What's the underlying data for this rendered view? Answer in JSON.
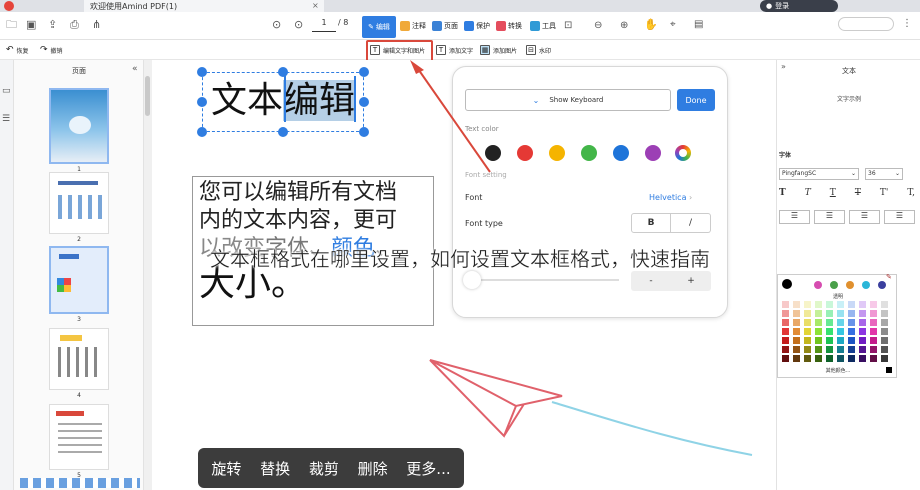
{
  "window": {
    "tab_title": "欢迎使用Amind PDF(1)",
    "login": "登录"
  },
  "toolbar": {
    "page_current": "1",
    "page_total": "/ 8",
    "edit": "编辑",
    "annotate": "注释",
    "page": "页面",
    "protect": "保护",
    "convert": "转换",
    "tools": "工具"
  },
  "subtoolbar": {
    "undo": "恢复",
    "redo": "撤销",
    "edit_text_image": "编辑文字和图片",
    "add_text": "添加文字",
    "add_image": "添加图片",
    "watermark": "水印"
  },
  "thumbnails": {
    "title": "页面",
    "pages": [
      {
        "label": "1",
        "selected": true
      },
      {
        "label": "2",
        "selected": false
      },
      {
        "label": "3",
        "selected": true
      },
      {
        "label": "4",
        "selected": false
      },
      {
        "label": "5",
        "selected": false
      }
    ]
  },
  "document": {
    "heading_plain": "文本",
    "heading_selected": "编辑",
    "body_line1": "您可以编辑所有文档",
    "body_line2": "内的文本内容，更可",
    "body_line3_a": "以改变",
    "body_line3_b": "字体",
    "body_line3_c": "、",
    "body_line3_d": "颜色",
    "body_line3_e": "、",
    "body_line4": "大小。"
  },
  "keyboard_panel": {
    "show_keyboard": "Show Keyboard",
    "done": "Done",
    "text_color": "Text color",
    "font_setting": "Font setting",
    "font_label": "Font",
    "font_value": "Helvetica",
    "font_type_label": "Font type",
    "bold": "B",
    "italic": "/",
    "minus": "-",
    "plus": "+",
    "colors": [
      "#222222",
      "#e53935",
      "#f5b400",
      "#43b649",
      "#1e74d9",
      "#9c3fb5"
    ]
  },
  "context_bar": {
    "rotate": "旋转",
    "replace": "替换",
    "crop": "裁剪",
    "delete": "删除",
    "more": "更多..."
  },
  "right_panel": {
    "collapse": "»",
    "title": "文本",
    "sample": "文字示例",
    "font_section": "字体",
    "font_family": "PingfangSC",
    "font_size": "36",
    "style_buttons": [
      "T",
      "T",
      "T",
      "T",
      "T'",
      "T,"
    ],
    "transparency": "透明",
    "more_colors": "其他颜色...",
    "top_colors": [
      "#000000",
      "#d64db0",
      "#4aa04a",
      "#e0902e",
      "#2bb6d8",
      "#3b3f9e"
    ]
  },
  "caption": "文本框格式在哪里设置，如何设置文本框格式，快速指南"
}
